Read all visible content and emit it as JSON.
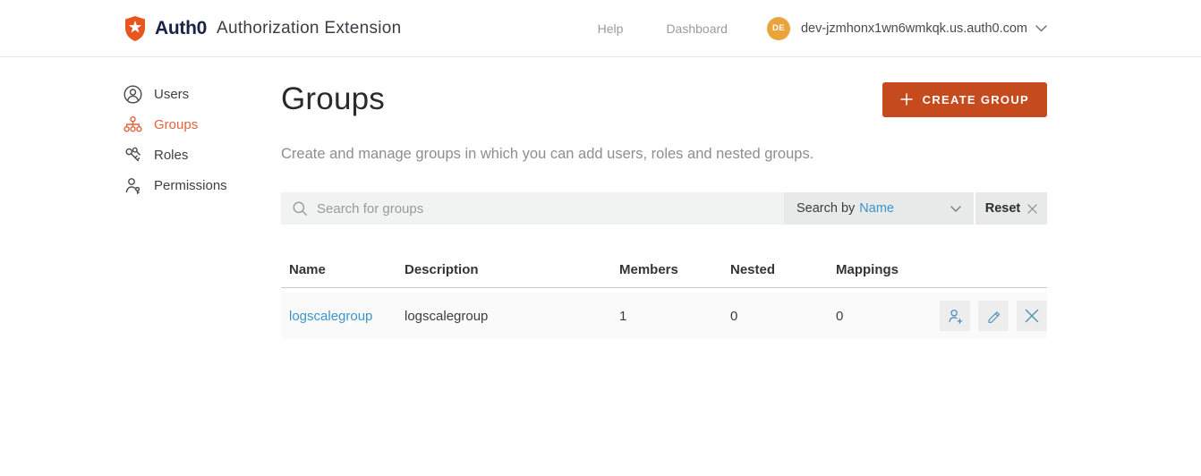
{
  "header": {
    "brand": "Auth0",
    "app_title": "Authorization Extension",
    "nav_help": "Help",
    "nav_dashboard": "Dashboard",
    "avatar_initials": "DE",
    "tenant_domain": "dev-jzmhonx1wn6wmkqk.us.auth0.com"
  },
  "sidebar": {
    "items": [
      {
        "label": "Users",
        "icon": "user-circle-icon"
      },
      {
        "label": "Groups",
        "icon": "org-chart-icon"
      },
      {
        "label": "Roles",
        "icon": "keys-icon"
      },
      {
        "label": "Permissions",
        "icon": "user-key-icon"
      }
    ],
    "active_item": "Groups"
  },
  "main": {
    "title": "Groups",
    "create_button_label": "CREATE GROUP",
    "description": "Create and manage groups in which you can add users, roles and nested groups.",
    "search": {
      "placeholder": "Search for groups",
      "search_by_label": "Search by",
      "search_by_value": "Name",
      "reset_label": "Reset"
    },
    "table": {
      "columns": [
        "Name",
        "Description",
        "Members",
        "Nested",
        "Mappings"
      ],
      "rows": [
        {
          "name": "logscalegroup",
          "description": "logscalegroup",
          "members": "1",
          "nested": "0",
          "mappings": "0"
        }
      ]
    }
  },
  "colors": {
    "brand_shield_orange": "#e8561f",
    "create_button_orange": "#c54a1d",
    "active_nav_orange": "#e0643c",
    "link_blue": "#3b95c9",
    "avatar_amber": "#e9a43b",
    "action_icon_blue": "#4a90b8",
    "search_bar_gray": "#f1f2f2",
    "row_bg_gray": "#fafafa"
  }
}
